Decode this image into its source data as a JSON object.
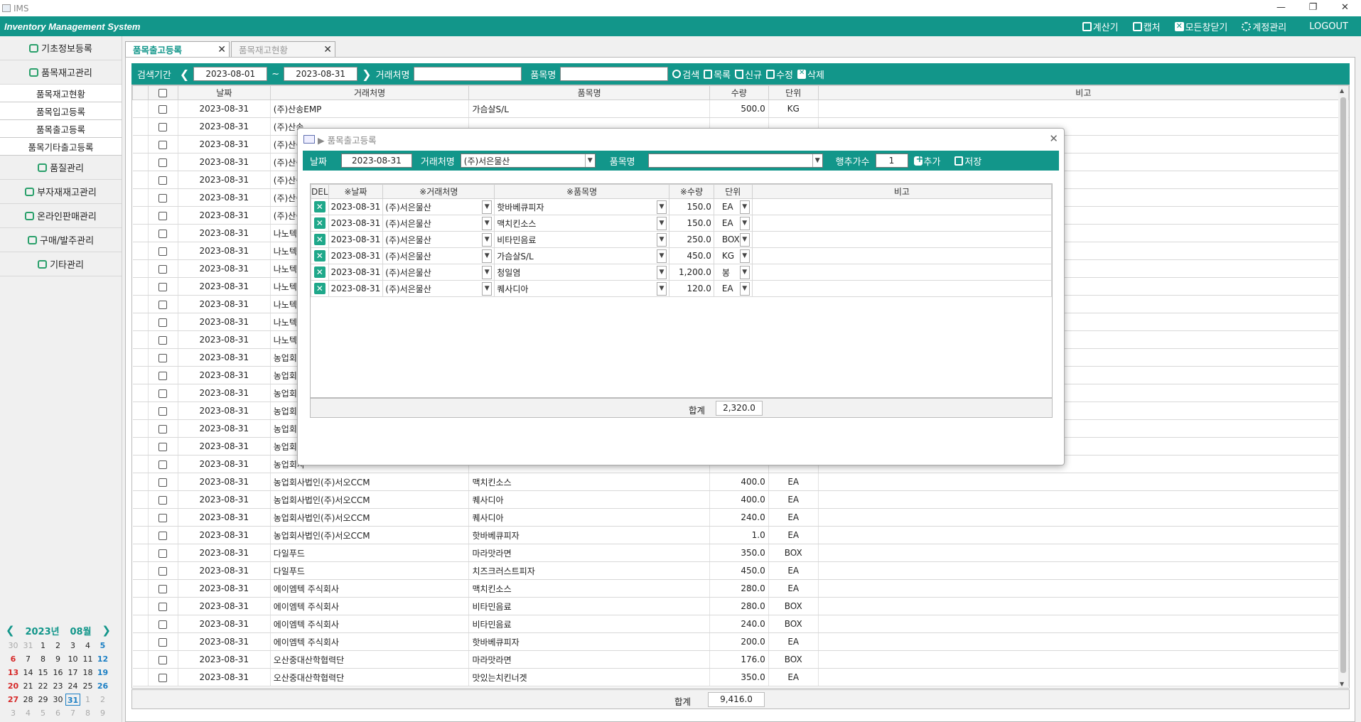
{
  "os": {
    "title": "IMS",
    "controls": [
      "—",
      "❐",
      "✕"
    ]
  },
  "app": {
    "title": "Inventory Management System",
    "menu": [
      "계산기",
      "캡처",
      "모든창닫기",
      "계정관리",
      "LOGOUT"
    ]
  },
  "sidebar": {
    "groups": [
      {
        "label": "기초정보등록"
      },
      {
        "label": "품목재고관리",
        "subs": [
          "품목재고현황",
          "품목입고등록",
          "품목출고등록",
          "품목기타출고등록"
        ]
      },
      {
        "label": "품질관리"
      },
      {
        "label": "부자재재고관리"
      },
      {
        "label": "온라인판매관리"
      },
      {
        "label": "구매/발주관리"
      },
      {
        "label": "기타관리"
      }
    ]
  },
  "calendar": {
    "year": "2023년",
    "month": "08월",
    "days": [
      {
        "d": "30",
        "t": "out"
      },
      {
        "d": "31",
        "t": "out"
      },
      {
        "d": "1",
        "t": ""
      },
      {
        "d": "2",
        "t": ""
      },
      {
        "d": "3",
        "t": ""
      },
      {
        "d": "4",
        "t": ""
      },
      {
        "d": "5",
        "t": "sat"
      },
      {
        "d": "6",
        "t": "sun"
      },
      {
        "d": "7",
        "t": ""
      },
      {
        "d": "8",
        "t": ""
      },
      {
        "d": "9",
        "t": ""
      },
      {
        "d": "10",
        "t": ""
      },
      {
        "d": "11",
        "t": ""
      },
      {
        "d": "12",
        "t": "sat"
      },
      {
        "d": "13",
        "t": "sun"
      },
      {
        "d": "14",
        "t": ""
      },
      {
        "d": "15",
        "t": ""
      },
      {
        "d": "16",
        "t": ""
      },
      {
        "d": "17",
        "t": ""
      },
      {
        "d": "18",
        "t": ""
      },
      {
        "d": "19",
        "t": "sat"
      },
      {
        "d": "20",
        "t": "sun"
      },
      {
        "d": "21",
        "t": ""
      },
      {
        "d": "22",
        "t": ""
      },
      {
        "d": "23",
        "t": ""
      },
      {
        "d": "24",
        "t": ""
      },
      {
        "d": "25",
        "t": ""
      },
      {
        "d": "26",
        "t": "sat"
      },
      {
        "d": "27",
        "t": "sun"
      },
      {
        "d": "28",
        "t": ""
      },
      {
        "d": "29",
        "t": ""
      },
      {
        "d": "30",
        "t": ""
      },
      {
        "d": "31",
        "t": "today"
      },
      {
        "d": "1",
        "t": "out"
      },
      {
        "d": "2",
        "t": "out"
      },
      {
        "d": "3",
        "t": "out"
      },
      {
        "d": "4",
        "t": "out"
      },
      {
        "d": "5",
        "t": "out"
      },
      {
        "d": "6",
        "t": "out"
      },
      {
        "d": "7",
        "t": "out"
      },
      {
        "d": "8",
        "t": "out"
      },
      {
        "d": "9",
        "t": "out"
      }
    ]
  },
  "tabs": [
    {
      "label": "품목출고등록",
      "active": true
    },
    {
      "label": "품목재고현황",
      "active": false
    }
  ],
  "toolbar": {
    "period_label": "검색기간",
    "date_from": "2023-08-01",
    "tilde": "~",
    "date_to": "2023-08-31",
    "vendor_label": "거래처명",
    "vendor_value": "",
    "item_label": "품목명",
    "item_value": "",
    "search": "검색",
    "list": "목록",
    "new": "신규",
    "edit": "수정",
    "delete": "삭제"
  },
  "grid": {
    "headers": [
      "",
      "날짜",
      "거래처명",
      "품목명",
      "수량",
      "단위",
      "비고"
    ],
    "rows": [
      [
        "2023-08-31",
        "(주)산송EMP",
        "가슴살S/L",
        "500.0",
        "KG"
      ],
      [
        "2023-08-31",
        "(주)산송",
        "",
        "",
        ""
      ],
      [
        "2023-08-31",
        "(주)산송",
        "",
        "",
        ""
      ],
      [
        "2023-08-31",
        "(주)산송",
        "",
        "",
        ""
      ],
      [
        "2023-08-31",
        "(주)산송",
        "",
        "",
        ""
      ],
      [
        "2023-08-31",
        "(주)산송",
        "",
        "",
        ""
      ],
      [
        "2023-08-31",
        "(주)산송",
        "",
        "",
        ""
      ],
      [
        "2023-08-31",
        "나노텍",
        "",
        "",
        ""
      ],
      [
        "2023-08-31",
        "나노텍",
        "",
        "",
        ""
      ],
      [
        "2023-08-31",
        "나노텍",
        "",
        "",
        ""
      ],
      [
        "2023-08-31",
        "나노텍",
        "",
        "",
        ""
      ],
      [
        "2023-08-31",
        "나노텍",
        "",
        "",
        ""
      ],
      [
        "2023-08-31",
        "나노텍",
        "",
        "",
        ""
      ],
      [
        "2023-08-31",
        "나노텍",
        "",
        "",
        ""
      ],
      [
        "2023-08-31",
        "농업회사",
        "",
        "",
        ""
      ],
      [
        "2023-08-31",
        "농업회사",
        "",
        "",
        ""
      ],
      [
        "2023-08-31",
        "농업회사",
        "",
        "",
        ""
      ],
      [
        "2023-08-31",
        "농업회사",
        "",
        "",
        ""
      ],
      [
        "2023-08-31",
        "농업회사",
        "",
        "",
        ""
      ],
      [
        "2023-08-31",
        "농업회사",
        "",
        "",
        ""
      ],
      [
        "2023-08-31",
        "농업회사",
        "",
        "",
        ""
      ],
      [
        "2023-08-31",
        "농업회사법인(주)서오CCM",
        "맥치킨소스",
        "400.0",
        "EA"
      ],
      [
        "2023-08-31",
        "농업회사법인(주)서오CCM",
        "퀘사디아",
        "400.0",
        "EA"
      ],
      [
        "2023-08-31",
        "농업회사법인(주)서오CCM",
        "퀘사디아",
        "240.0",
        "EA"
      ],
      [
        "2023-08-31",
        "농업회사법인(주)서오CCM",
        "핫바베큐피자",
        "1.0",
        "EA"
      ],
      [
        "2023-08-31",
        "다일푸드",
        "마라맛라면",
        "350.0",
        "BOX"
      ],
      [
        "2023-08-31",
        "다일푸드",
        "치즈크러스트피자",
        "450.0",
        "EA"
      ],
      [
        "2023-08-31",
        "에이엠텍 주식회사",
        "맥치킨소스",
        "280.0",
        "EA"
      ],
      [
        "2023-08-31",
        "에이엠텍 주식회사",
        "비타민음료",
        "280.0",
        "BOX"
      ],
      [
        "2023-08-31",
        "에이엠텍 주식회사",
        "비타민음료",
        "240.0",
        "BOX"
      ],
      [
        "2023-08-31",
        "에이엠텍 주식회사",
        "핫바베큐피자",
        "200.0",
        "EA"
      ],
      [
        "2023-08-31",
        "오산중대산학협력단",
        "마라맛라면",
        "176.0",
        "BOX"
      ],
      [
        "2023-08-31",
        "오산중대산학협력단",
        "맛있는치킨너겟",
        "350.0",
        "EA"
      ]
    ],
    "sum_label": "합계",
    "sum_value": "9,416.0"
  },
  "modal": {
    "title": "▶ 품목출고등록",
    "date_label": "날짜",
    "date_value": "2023-08-31",
    "vendor_label": "거래처명",
    "vendor_value": "(주)서은물산",
    "item_label": "품목명",
    "item_value": "",
    "rows_label": "행추가수",
    "rows_value": "1",
    "add": "추가",
    "save": "저장",
    "headers": [
      "DEL",
      "※날짜",
      "※거래처명",
      "※품목명",
      "※수량",
      "단위",
      "비고"
    ],
    "rows": [
      [
        "2023-08-31",
        "(주)서은물산",
        "핫바베큐피자",
        "150.0",
        "EA"
      ],
      [
        "2023-08-31",
        "(주)서은물산",
        "맥치킨소스",
        "150.0",
        "EA"
      ],
      [
        "2023-08-31",
        "(주)서은물산",
        "비타민음료",
        "250.0",
        "BOX"
      ],
      [
        "2023-08-31",
        "(주)서은물산",
        "가슴살S/L",
        "450.0",
        "KG"
      ],
      [
        "2023-08-31",
        "(주)서은물산",
        "청일염",
        "1,200.0",
        "봉"
      ],
      [
        "2023-08-31",
        "(주)서은물산",
        "퀘사디아",
        "120.0",
        "EA"
      ]
    ],
    "sum_label": "합계",
    "sum_value": "2,320.0"
  },
  "colors": {
    "accent": "#12968a",
    "sunday": "#d62828",
    "saturday": "#1b7fc4"
  }
}
